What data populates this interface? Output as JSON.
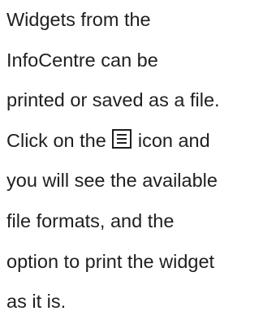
{
  "help_text": {
    "line1": "Widgets from the",
    "line2": "InfoCentre can be",
    "line3": "printed or saved as a file.",
    "line4_before_icon": "Click on the ",
    "line4_after_icon": " icon and",
    "line5": "you will see the available",
    "line6": "file formats, and the",
    "line7": "option to print the widget",
    "line8": "as it is.",
    "icon": "hamburger-menu-icon"
  }
}
